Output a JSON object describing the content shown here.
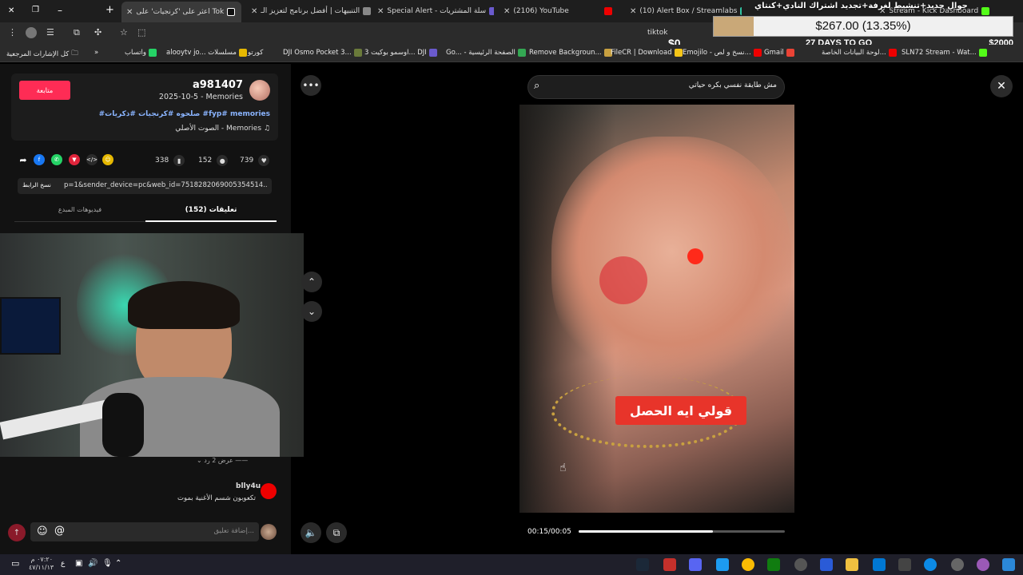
{
  "tabs": [
    {
      "label": "اعثر على 'كرنجيات' على Tok",
      "active": true
    },
    {
      "label": "التنبيهات | أفضل برنامج لتعزيز الـ"
    },
    {
      "label": "Special Alert - سلة المشتريات"
    },
    {
      "label": "(2106) YouTube"
    },
    {
      "label": "(10) Alert Box / Streamlabs"
    },
    {
      "label": "Stream - Kick Dashboard"
    }
  ],
  "alert_overlay": "جوال جديد+تنشيط لغرفة+تجديد اشتراك النادي+كنتاي",
  "address": "tiktok",
  "goal": {
    "current": "$267.00 (13.35%)",
    "progress": 0.1335,
    "start": "$0",
    "days": "27 DAYS TO GO",
    "target": "$2000"
  },
  "bookmarks": [
    "كل الإشارات المرجعية",
    "واتساب",
    "alooytv jo... مسلسلات",
    "كورتو",
    "DJI Osmo Pocket 3...",
    "اوسمو بوكيت 3... DJI",
    "Go... - الصفحة الرئيسية",
    "Remove Backgroun...",
    "FileCR | Download",
    "Emojilo - نسخ و لص...",
    "Gmail",
    "لوحة البيانات الخاصة...",
    "SLN72 Stream - Wat..."
  ],
  "post": {
    "username": "a981407",
    "date_line": "2025-10-5 - Memories",
    "follow": "متابعة",
    "hashtags": "#صلحوه #كرنجيات #ذكريات #fyp# memories",
    "music": "الصوت الأصلي - Memories",
    "likes": "739",
    "comments": "152",
    "saves": "338",
    "link": "p=1&sender_device=pc&web_id=7518282069005354514...",
    "copy": "نسخ الرابط"
  },
  "tabs_panel": {
    "comments": "(152) تعليقات",
    "creator": "فيديوهات المبدع"
  },
  "replies": "عرض 2 رد",
  "comment": {
    "user": "blly4u",
    "text": "تكعوبون شسم الأغنية بموت"
  },
  "input": {
    "placeholder": "إضافة تعليق..."
  },
  "video": {
    "search": "مش طايقة نفسي بكره حياتي",
    "caption": "قولي ايه الحصل",
    "time": "00:15/00:05",
    "progress": 0.65
  },
  "clock": {
    "time": "٠٧:٢٠ م",
    "date": "٤٧/١١/١٣"
  },
  "colors": {
    "follow": "#fe2c55",
    "caption": "#e8342a",
    "accent": "#8ab4ff"
  }
}
